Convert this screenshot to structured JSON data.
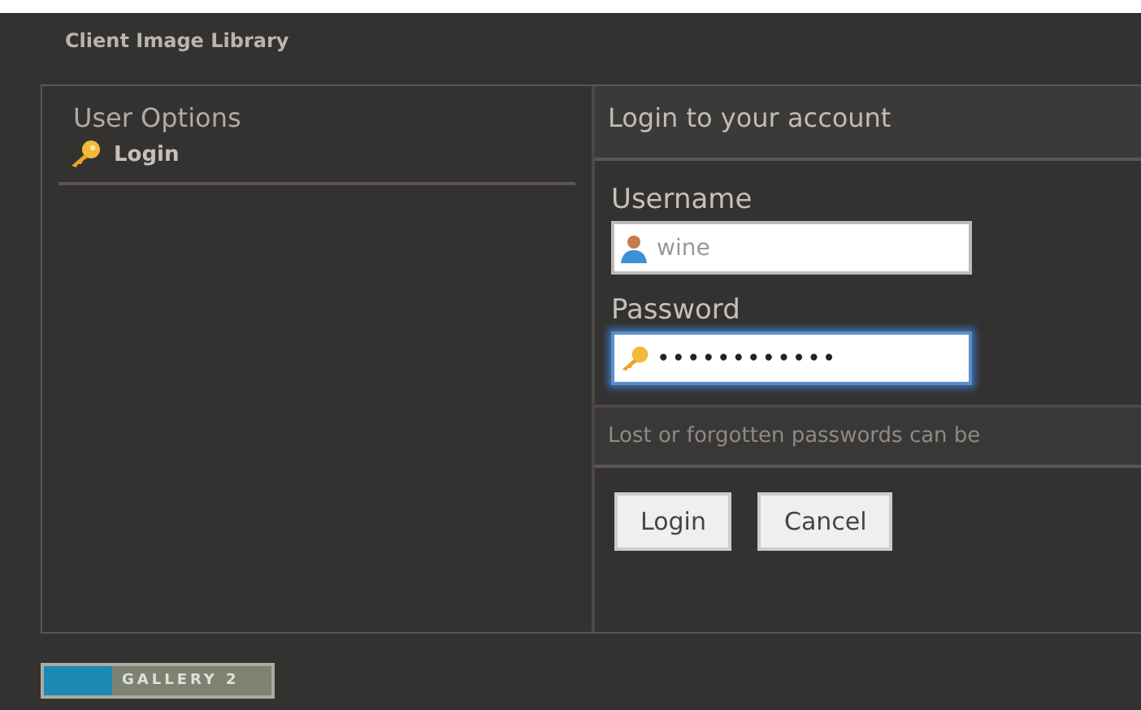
{
  "site_title": "Client Image Library",
  "sidebar": {
    "heading": "User Options",
    "items": [
      {
        "label": "Login",
        "selected": false
      }
    ]
  },
  "login": {
    "heading": "Login to your account",
    "fields": [
      {
        "label": "Username",
        "value": "wine",
        "kind": "user",
        "focused": false
      },
      {
        "label": "Password",
        "value": "••••••••••••",
        "kind": "key",
        "focused": true
      }
    ],
    "note": "Lost or forgotten passwords can be",
    "buttons": [
      "Login",
      "Cancel"
    ]
  },
  "footer": {
    "badge": "GALLERY 2"
  }
}
